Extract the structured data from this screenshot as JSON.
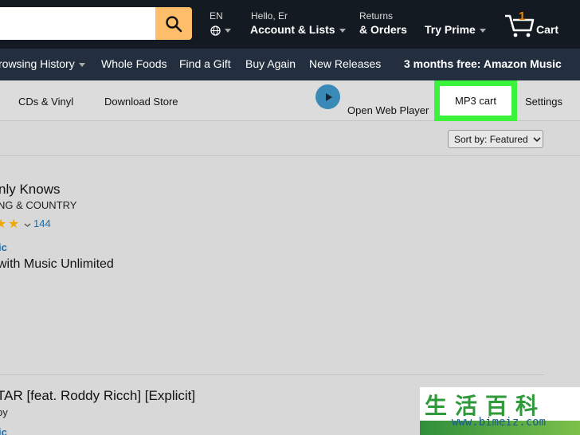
{
  "topnav": {
    "lang": "EN",
    "greeting": "Hello, Er",
    "account": "Account & Lists",
    "returns": "Returns",
    "orders": "& Orders",
    "prime": "Try Prime",
    "cart_count": "1",
    "cart": "Cart"
  },
  "subnav": {
    "items": [
      "rowsing History",
      "Whole Foods",
      "Find a Gift",
      "Buy Again",
      "New Releases"
    ],
    "promo": "3 months free: Amazon Music"
  },
  "musicbar": {
    "cds": "CDs & Vinyl",
    "download": "Download Store",
    "web_player": "Open Web Player",
    "mp3cart": "MP3 cart",
    "settings": "Settings"
  },
  "sort": {
    "label": "Sort by:",
    "value": "Featured"
  },
  "results": [
    {
      "title": "nly Knows",
      "genre": "NG & COUNTRY",
      "rating_count": "144",
      "link": "ic",
      "unlimited": "with Music Unlimited"
    },
    {
      "title": "TAR [feat. Roddy Ricch] [Explicit]",
      "artist": "by",
      "link": "ic"
    }
  ],
  "watermark": {
    "chars": "生活百科",
    "url": "www.bimeiz.com"
  },
  "colors": {
    "nav_dark": "#131a22",
    "subnav": "#232f3e",
    "search_button": "#febd69",
    "highlight": "#3cf33c",
    "link": "#1a6aa8",
    "star": "#f0a800"
  }
}
